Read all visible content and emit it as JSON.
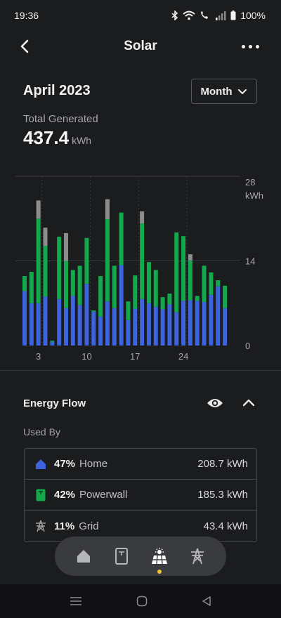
{
  "status_bar": {
    "time": "19:36",
    "battery": "100%"
  },
  "header": {
    "title": "Solar"
  },
  "period": {
    "title": "April 2023",
    "range_label": "Month"
  },
  "total": {
    "label": "Total Generated",
    "value": "437.4",
    "unit": "kWh"
  },
  "colors": {
    "solar_home": "#3d63dd",
    "powerwall": "#12a84b",
    "grid": "#8c8c8c",
    "background": "#1b1c1e",
    "accent_dot": "#f2c230"
  },
  "chart_data": {
    "type": "bar",
    "stacked": true,
    "x": [
      1,
      2,
      3,
      4,
      5,
      6,
      7,
      8,
      9,
      10,
      11,
      12,
      13,
      14,
      15,
      16,
      17,
      18,
      19,
      20,
      21,
      22,
      23,
      24,
      25,
      26,
      27,
      28,
      29,
      30
    ],
    "x_tick_labels": [
      "3",
      "10",
      "17",
      "24"
    ],
    "y_unit": "kWh",
    "y_tick_labels": [
      "28",
      "14",
      "0"
    ],
    "ylim": [
      0,
      28
    ],
    "grid": true,
    "series": [
      {
        "name": "Home",
        "color": "#3d63dd",
        "values": [
          9.0,
          7.0,
          7.0,
          8.1,
          0.6,
          7.7,
          6.2,
          8.2,
          6.7,
          10.2,
          5.6,
          4.8,
          7.3,
          6.2,
          13.3,
          4.2,
          6.1,
          7.7,
          7.0,
          6.4,
          6.0,
          6.8,
          5.5,
          7.4,
          7.5,
          7.4,
          7.2,
          8.4,
          9.8,
          6.2
        ]
      },
      {
        "name": "Powerwall",
        "color": "#12a84b",
        "values": [
          2.5,
          5.2,
          14.0,
          8.4,
          0.2,
          10.3,
          7.8,
          4.3,
          6.5,
          7.6,
          0.2,
          6.7,
          13.6,
          7.0,
          8.7,
          3.1,
          5.5,
          12.5,
          6.8,
          6.1,
          2.0,
          1.8,
          13.2,
          10.7,
          6.6,
          0.8,
          6.0,
          3.7,
          1.0,
          3.7
        ]
      },
      {
        "name": "Grid",
        "color": "#8c8c8c",
        "values": [
          0,
          0,
          3.0,
          3.0,
          0,
          0,
          4.6,
          0,
          0,
          0,
          0,
          0,
          3.3,
          0,
          0,
          0,
          0,
          2.0,
          0,
          0,
          0,
          0,
          0,
          0,
          1.0,
          0,
          0,
          0,
          0,
          0
        ]
      }
    ]
  },
  "energy_flow": {
    "title": "Energy Flow",
    "used_by_label": "Used By",
    "rows": [
      {
        "icon": "home-icon",
        "percent": "47%",
        "name": "Home",
        "value": "208.7 kWh"
      },
      {
        "icon": "powerwall-icon",
        "percent": "42%",
        "name": "Powerwall",
        "value": "185.3 kWh"
      },
      {
        "icon": "grid-tower-icon",
        "percent": "11%",
        "name": "Grid",
        "value": "43.4 kWh"
      }
    ]
  },
  "bottom_nav": {
    "items": [
      "home-icon",
      "powerwall-icon",
      "solar-panel-icon",
      "grid-tower-icon"
    ],
    "active": "solar-panel-icon"
  }
}
